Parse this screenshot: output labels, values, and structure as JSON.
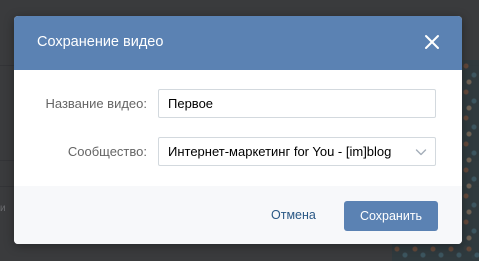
{
  "dialog": {
    "title": "Сохранение видео",
    "close_icon": "close-icon",
    "accent_color": "#5b82b3"
  },
  "form": {
    "video_name_label": "Название видео:",
    "video_name_value": "Первое",
    "community_label": "Сообщество:",
    "community_value": "Интернет-маркетинг for You - [im]blog",
    "community_dropdown_icon": "chevron-down-icon"
  },
  "footer": {
    "cancel_label": "Отмена",
    "save_label": "Сохранить",
    "link_color": "#2a5885"
  }
}
